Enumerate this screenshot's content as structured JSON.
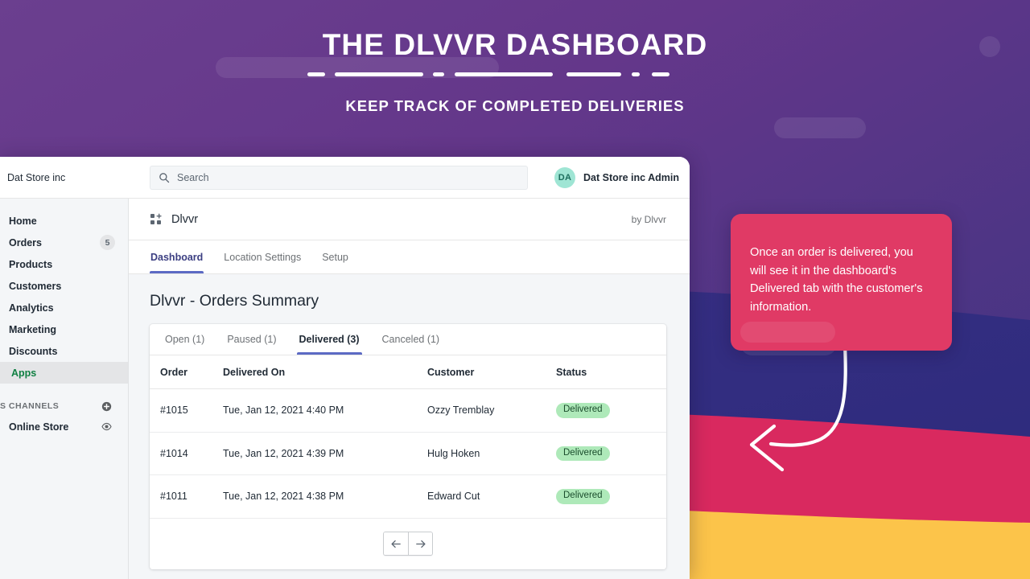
{
  "hero": {
    "title": "THE DLVVR DASHBOARD",
    "subtitle": "KEEP TRACK OF COMPLETED DELIVERIES"
  },
  "topbar": {
    "store_name": "Dat Store inc",
    "search_placeholder": "Search",
    "avatar_initials": "DA",
    "user_name": "Dat Store inc Admin"
  },
  "sidebar": {
    "items": [
      {
        "label": "Home",
        "badge": "",
        "active": false
      },
      {
        "label": "Orders",
        "badge": "5",
        "active": false
      },
      {
        "label": "Products",
        "badge": "",
        "active": false
      },
      {
        "label": "Customers",
        "badge": "",
        "active": false
      },
      {
        "label": "Analytics",
        "badge": "",
        "active": false
      },
      {
        "label": "Marketing",
        "badge": "",
        "active": false
      },
      {
        "label": "Discounts",
        "badge": "",
        "active": false
      },
      {
        "label": "Apps",
        "badge": "",
        "active": true
      }
    ],
    "section_label": "S CHANNELS",
    "channels": [
      {
        "label": "Online Store"
      }
    ]
  },
  "app_header": {
    "title": "Dlvvr",
    "by": "by Dlvvr"
  },
  "app_tabs": [
    {
      "label": "Dashboard",
      "active": true
    },
    {
      "label": "Location Settings",
      "active": false
    },
    {
      "label": "Setup",
      "active": false
    }
  ],
  "main": {
    "page_title": "Dlvvr - Orders Summary",
    "card_tabs": [
      {
        "label": "Open (1)",
        "active": false
      },
      {
        "label": "Paused (1)",
        "active": false
      },
      {
        "label": "Delivered (3)",
        "active": true
      },
      {
        "label": "Canceled (1)",
        "active": false
      }
    ],
    "table": {
      "columns": [
        "Order",
        "Delivered On",
        "Customer",
        "Status"
      ],
      "rows": [
        {
          "order": "#1015",
          "delivered_on": "Tue, Jan 12, 2021 4:40 PM",
          "customer": "Ozzy Tremblay",
          "status": "Delivered"
        },
        {
          "order": "#1014",
          "delivered_on": "Tue, Jan 12, 2021 4:39 PM",
          "customer": "Hulg Hoken",
          "status": "Delivered"
        },
        {
          "order": "#1011",
          "delivered_on": "Tue, Jan 12, 2021 4:38 PM",
          "customer": "Edward Cut",
          "status": "Delivered"
        }
      ]
    },
    "pagination": {
      "prev": "←",
      "next": "→"
    }
  },
  "callout": {
    "text": "Once an order is delivered, you will see it in the dashboard's Delivered tab with the customer's information."
  },
  "colors": {
    "hero_purple": "#64378a",
    "hero_purple_dark": "#3f3382",
    "wave_indigo": "#2f2d7e",
    "wave_pink": "#d9295f",
    "wave_yellow": "#fcc44a",
    "callout_pink": "#e03a65",
    "accent_indigo": "#5c6ac4",
    "badge_green": "#aee9b9",
    "apps_green": "#108043",
    "avatar_mint": "#9fe5d4"
  }
}
